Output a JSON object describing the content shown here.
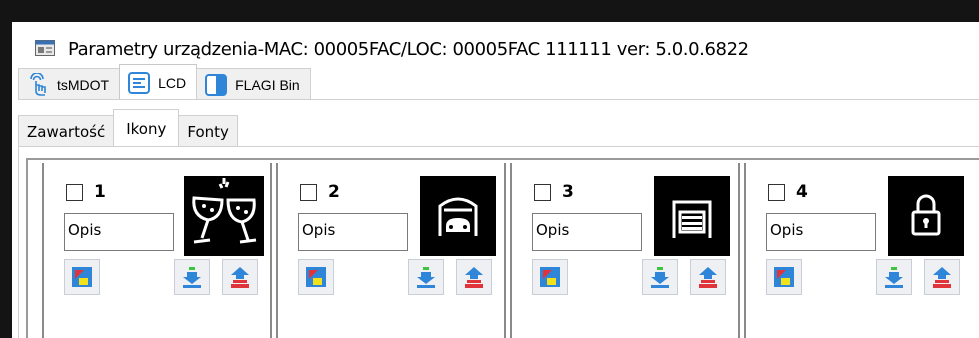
{
  "window": {
    "title": "Parametry urządzenia-MAC: 00005FAC/LOC: 00005FAC 111111 ver: 5.0.0.6822"
  },
  "main_tabs": [
    {
      "label": "tsMDOT",
      "icon": "touch-hand-icon"
    },
    {
      "label": "LCD",
      "icon": "lcd-list-icon",
      "active": true
    },
    {
      "label": "FLAGI Bin",
      "icon": "flag-panel-icon"
    }
  ],
  "sub_tabs": [
    {
      "label": "Zawartość"
    },
    {
      "label": "Ikony",
      "active": true
    },
    {
      "label": "Fonty"
    }
  ],
  "cards": [
    {
      "number": "1",
      "placeholder": "Opis",
      "image": "champagne-glasses-icon"
    },
    {
      "number": "2",
      "placeholder": "Opis",
      "image": "garage-car-icon"
    },
    {
      "number": "3",
      "placeholder": "Opis",
      "image": "garage-door-icon"
    },
    {
      "number": "4",
      "placeholder": "Opis",
      "image": "padlock-icon"
    }
  ],
  "colors": {
    "background": "#141414",
    "tab_bar": "#f0f0f0",
    "card_border": "#8a8a8a",
    "accent_blue": "#2f86d8",
    "accent_red": "#e0343a",
    "accent_green": "#3cc43c",
    "accent_yellow": "#f2e21a"
  }
}
